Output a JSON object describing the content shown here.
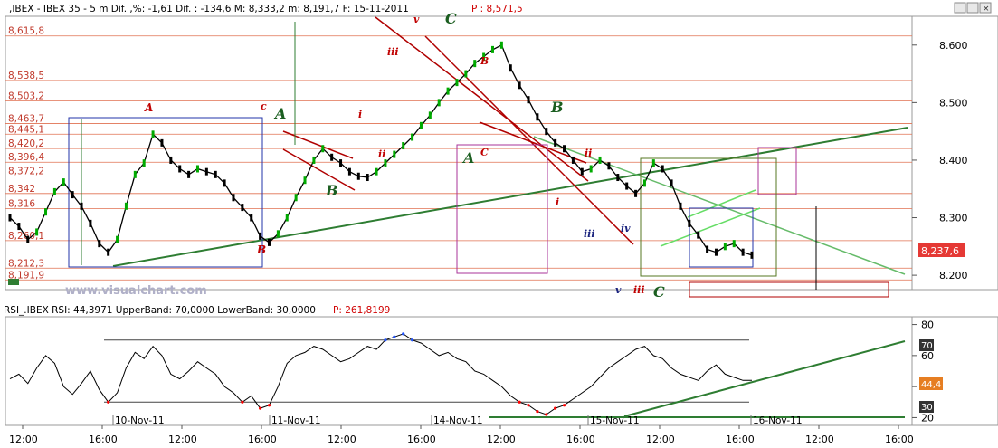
{
  "header": {
    "title": ",IBEX - IBEX 35 -  5 m Dif. ,%: -1,61 Dif. : -134,6 M: 8,333,2 m: 8,191,7 F: 15-11-2011",
    "price_label": "P : 8,571,5"
  },
  "rsi_header": {
    "title": "RSI_.IBEX RSI: 44,3971 UpperBand: 70,0000 LowerBand: 30,0000",
    "price_label": "P: 261,8199"
  },
  "watermark": "www.visualchart.com",
  "colors": {
    "price_line": "#000000",
    "up_candle": "#00aa00",
    "down_candle": "#000000",
    "fib_lines": "#e07050",
    "green_lines": "#2e7d32",
    "red_channel": "#b00000",
    "current_price_bg": "#e53935",
    "rsi_line": "#000000",
    "rsi_up_segment": "#2255ff",
    "rsi_down_segment": "#ff0000"
  },
  "chart_data": [
    {
      "type": "line",
      "name": "IBEX 35 5m price",
      "x_ticks": [
        "12:00",
        "16:00",
        "12:00",
        "16:00",
        "12:00",
        "16:00",
        "12:00",
        "16:00",
        "12:00",
        "16:00",
        "12:00",
        "16:00"
      ],
      "date_labels": [
        "10-Nov-11",
        "11-Nov-11",
        "14-Nov-11",
        "15-Nov-11",
        "16-Nov-11"
      ],
      "y_ticks": [
        "8.600",
        "8.500",
        "8.400",
        "8.300",
        "8.200"
      ],
      "ylim": [
        8175,
        8650
      ],
      "fib_levels": [
        "8,615,8",
        "8,538,5",
        "8,503,2",
        "8,463,7",
        "8,445,1",
        "8,420,2",
        "8,396,4",
        "8,372,2",
        "8,342",
        "8,316",
        "8,260,1",
        "8,212,3",
        "8,191,9"
      ],
      "current_price": "8,237,6",
      "x": [
        0,
        5,
        10,
        15,
        20,
        25,
        30,
        35,
        40,
        45,
        50,
        55,
        60,
        65,
        70,
        75,
        80,
        85,
        90,
        95,
        100,
        105,
        110,
        115,
        120,
        125,
        130,
        135,
        140,
        145,
        150,
        155,
        160,
        165,
        170,
        175,
        180,
        185,
        190,
        195,
        200,
        205,
        210,
        215,
        220,
        225,
        230,
        235,
        240,
        245,
        250,
        255,
        260,
        265,
        270,
        275,
        280,
        285,
        290,
        295,
        300,
        305,
        310,
        315,
        320,
        325,
        330,
        335,
        340,
        345,
        350,
        355,
        360,
        365,
        370,
        375,
        380,
        385,
        390,
        395,
        400,
        405,
        410,
        415
      ],
      "values": [
        8300,
        8285,
        8262,
        8275,
        8310,
        8345,
        8362,
        8340,
        8320,
        8290,
        8255,
        8240,
        8262,
        8320,
        8375,
        8395,
        8445,
        8430,
        8400,
        8385,
        8375,
        8385,
        8380,
        8375,
        8360,
        8335,
        8318,
        8300,
        8268,
        8257,
        8272,
        8300,
        8335,
        8365,
        8400,
        8420,
        8405,
        8395,
        8380,
        8372,
        8370,
        8380,
        8395,
        8410,
        8425,
        8440,
        8460,
        8478,
        8500,
        8520,
        8535,
        8550,
        8568,
        8580,
        8592,
        8600,
        8560,
        8530,
        8505,
        8475,
        8450,
        8430,
        8420,
        8400,
        8380,
        8385,
        8400,
        8390,
        8370,
        8355,
        8342,
        8360,
        8395,
        8385,
        8360,
        8320,
        8290,
        8270,
        8245,
        8240,
        8250,
        8255,
        8240,
        8235
      ]
    },
    {
      "type": "line",
      "name": "RSI",
      "y_ticks": [
        "80",
        "60",
        "40",
        "20"
      ],
      "ylim": [
        15,
        85
      ],
      "bands": [
        "70",
        "30"
      ],
      "current_value": "44,4",
      "x": [
        0,
        5,
        10,
        15,
        20,
        25,
        30,
        35,
        40,
        45,
        50,
        55,
        60,
        65,
        70,
        75,
        80,
        85,
        90,
        95,
        100,
        105,
        110,
        115,
        120,
        125,
        130,
        135,
        140,
        145,
        150,
        155,
        160,
        165,
        170,
        175,
        180,
        185,
        190,
        195,
        200,
        205,
        210,
        215,
        220,
        225,
        230,
        235,
        240,
        245,
        250,
        255,
        260,
        265,
        270,
        275,
        280,
        285,
        290,
        295,
        300,
        305,
        310,
        315,
        320,
        325,
        330,
        335,
        340,
        345,
        350,
        355,
        360,
        365,
        370,
        375,
        380,
        385,
        390,
        395,
        400,
        405,
        410,
        415
      ],
      "values": [
        45,
        48,
        42,
        52,
        60,
        55,
        40,
        35,
        42,
        50,
        38,
        30,
        36,
        52,
        62,
        58,
        66,
        60,
        48,
        45,
        50,
        56,
        52,
        48,
        40,
        36,
        30,
        34,
        26,
        28,
        40,
        55,
        60,
        62,
        66,
        64,
        60,
        56,
        58,
        62,
        66,
        64,
        70,
        72,
        74,
        70,
        68,
        64,
        60,
        62,
        58,
        56,
        50,
        48,
        44,
        40,
        34,
        30,
        28,
        24,
        22,
        26,
        28,
        32,
        36,
        40,
        46,
        52,
        56,
        60,
        64,
        66,
        60,
        58,
        52,
        48,
        46,
        44,
        50,
        54,
        48,
        46,
        44,
        44
      ]
    }
  ]
}
